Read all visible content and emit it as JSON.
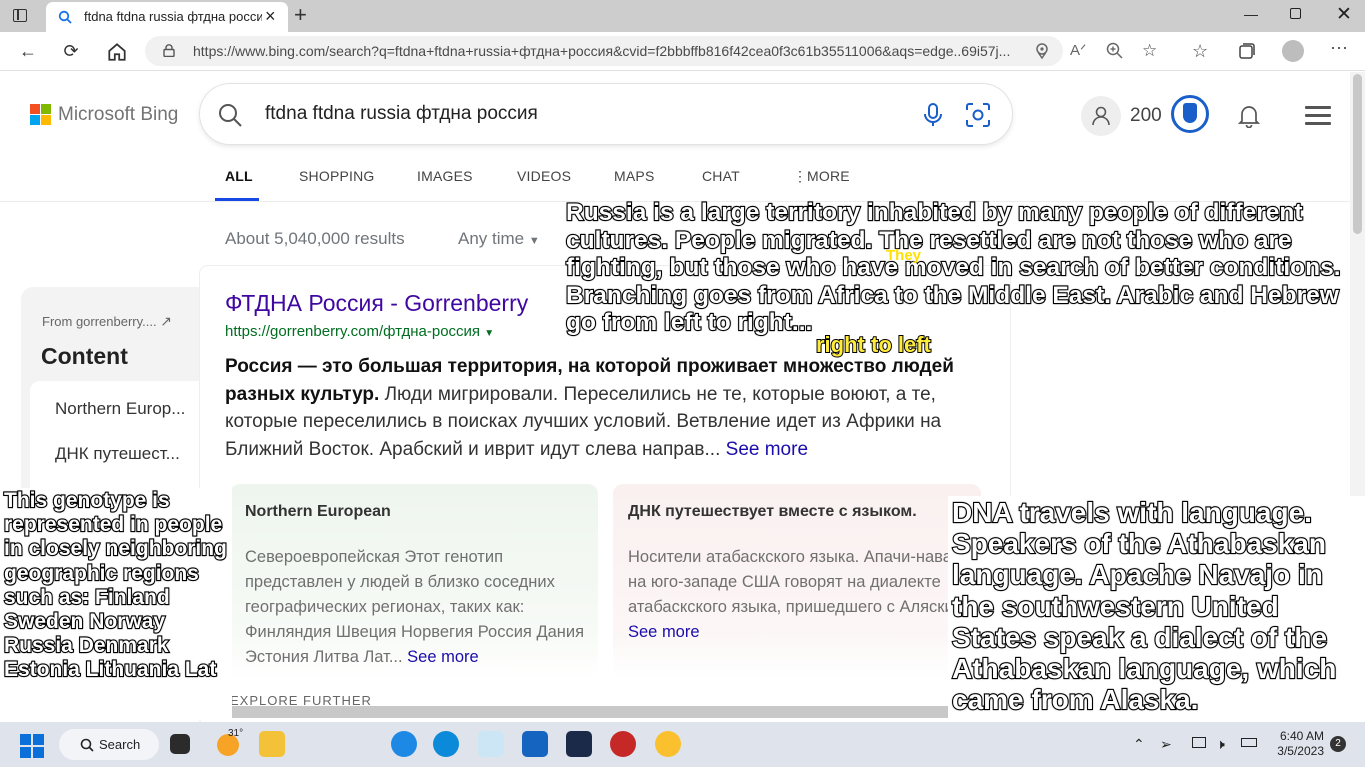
{
  "browser": {
    "tab_title": "ftdna ftdna russia фтдна россия",
    "url": "https://www.bing.com/search?q=ftdna+ftdna+russia+фтдна+россия&cvid=f2bbbffb816f42cea0f3c61b35511006&aqs=edge..69i57j..."
  },
  "bing": {
    "logo_text": "Microsoft Bing",
    "query": "ftdna ftdna russia фтдна россия",
    "points": "200",
    "tabs": [
      "ALL",
      "SHOPPING",
      "IMAGES",
      "VIDEOS",
      "MAPS",
      "CHAT",
      "MORE"
    ],
    "results_count": "About 5,040,000 results",
    "time_filter": "Any time"
  },
  "left_panel": {
    "from": "From gorrenberry....",
    "title": "Content",
    "items": [
      "Northern Europ...",
      "ДНК путешест..."
    ]
  },
  "result": {
    "title": "ФТДНА Россия - Gorrenberry",
    "url": "https://gorrenberry.com/фтдна-россия",
    "snippet_bold": "Россия — это большая территория, на которой проживает множество людей разных культур.",
    "snippet_rest": " Люди мигрировали. Переселились не те, которые воюют, а те, которые переселились в поисках лучших условий. Ветвление идет из Африки на Ближний Восток. Арабский и иврит идут слева направ...",
    "see_more": "See more",
    "cards": [
      {
        "heading": "Northern European",
        "body": "Североевропейская Этот генотип представлен у людей в близко соседних географических регионах, таких как: Финляндия Швеция Норвегия Россия Дания Эстония Литва Лат...",
        "see_more": "See more"
      },
      {
        "heading": "ДНК путешествует вместе с языком.",
        "body": "Носители атабаскского языка. Апачи-навахо на юго-западе США говорят на диалекте атабаскского языка, пришедшего с Аляски.",
        "see_more": "See more"
      }
    ],
    "explore": "EXPLORE FURTHER"
  },
  "captions": {
    "top": "Russia is a large territory inhabited by many people of different cultures. People migrated. The resettled are not those who are fighting, but those who have moved in search of better conditions. Branching goes from Africa to the Middle East. Arabic and Hebrew go from left to right...",
    "they": "They",
    "rtl": "right to left",
    "left": "This genotype is represented in people in closely neighboring geographic regions such as: Finland Sweden Norway Russia Denmark Estonia Lithuania Lat",
    "right": "DNA travels with language. Speakers of the Athabaskan language. Apache Navajo in the southwestern United States speak a dialect of the Athabaskan language, which came from Alaska."
  },
  "taskbar": {
    "search_label": "Search",
    "weather": "31°",
    "time": "6:40 AM",
    "date": "3/5/2023",
    "notifications": "2"
  }
}
